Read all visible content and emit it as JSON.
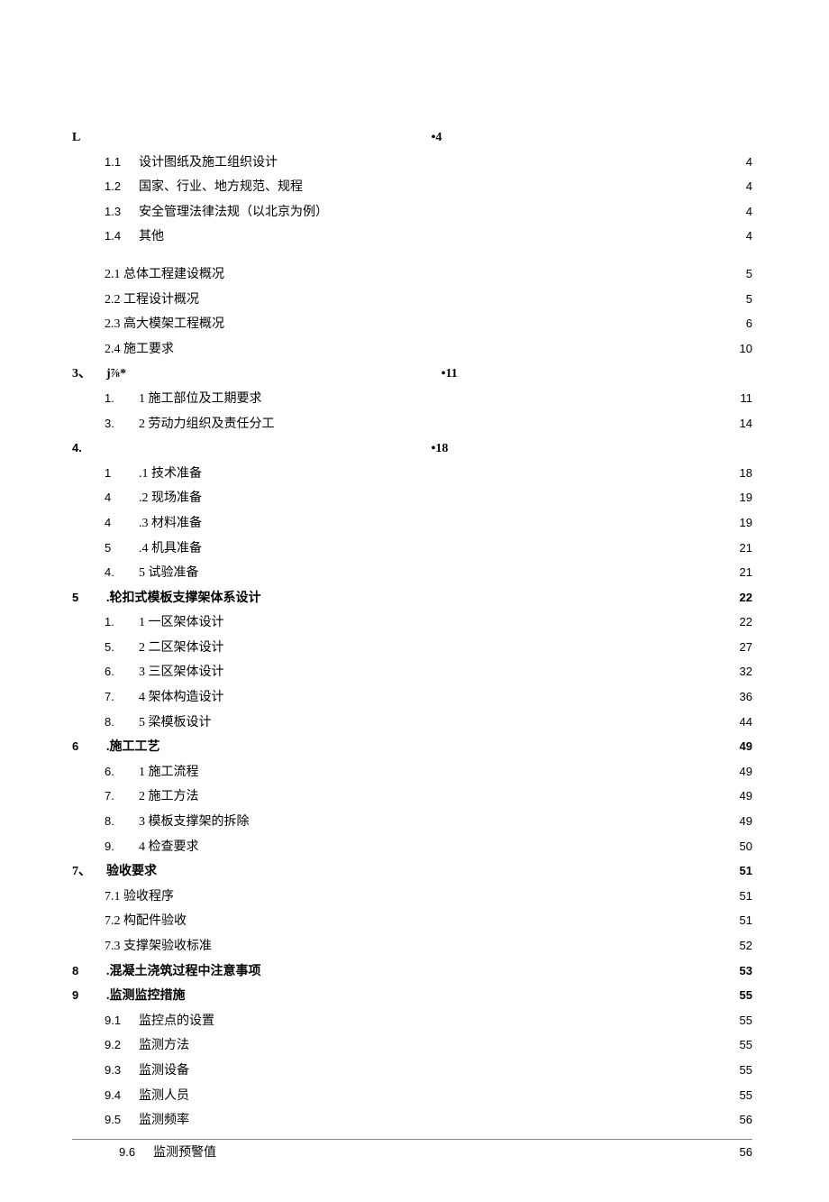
{
  "toc": [
    {
      "level": 1,
      "num": "L",
      "numClass": "cn",
      "text": "",
      "leader": "thick",
      "page": "4",
      "hasPage": false,
      "inlinePage": "•4"
    },
    {
      "level": 2,
      "num": "1.1",
      "text": "设计图纸及施工组织设计",
      "page": "4"
    },
    {
      "level": 2,
      "num": "1.2",
      "text": "国家、行业、地方规范、规程",
      "page": "4"
    },
    {
      "level": 2,
      "num": "1.3",
      "text": "安全管理法律法规（以北京为例）",
      "page": "4"
    },
    {
      "level": 2,
      "num": "1.4",
      "text": "其他",
      "page": "4"
    },
    {
      "gap": true
    },
    {
      "level": 2,
      "num": "",
      "text": "2.1 总体工程建设概况",
      "page": "5"
    },
    {
      "level": 2,
      "num": "",
      "text": "2.2 工程设计概况",
      "page": "5"
    },
    {
      "level": 2,
      "num": "",
      "text": "2.3 高大模架工程概况",
      "page": "6"
    },
    {
      "level": 2,
      "num": "",
      "text": "2.4 施工要求",
      "page": "10"
    },
    {
      "level": 1,
      "num": "3、",
      "numClass": "cn",
      "text": "j⅞*",
      "leader": "thick",
      "page": "11",
      "hasPage": false,
      "inlinePage": "•11"
    },
    {
      "level": 2,
      "num": "1.",
      "text": "1 施工部位及工期要求",
      "page": "11"
    },
    {
      "level": 2,
      "num": "3.",
      "text": "2 劳动力组织及责任分工",
      "page": "14"
    },
    {
      "level": 1,
      "num": "4.",
      "text": "",
      "leader": "thick",
      "page": "18",
      "hasPage": false,
      "inlinePage": "•18"
    },
    {
      "level": 2,
      "num": "1",
      "text": ".1 技术准备",
      "page": "18"
    },
    {
      "level": 2,
      "num": "4",
      "text": ".2 现场准备",
      "page": "19"
    },
    {
      "level": 2,
      "num": "4",
      "text": ".3 材料准备",
      "page": "19"
    },
    {
      "level": 2,
      "num": "5",
      "text": ".4 机具准备",
      "page": "21"
    },
    {
      "level": 2,
      "num": "4.",
      "text": "5 试验准备",
      "page": "21"
    },
    {
      "level": 1,
      "num": "5",
      "text": ".轮扣式模板支撑架体系设计",
      "leader": "dot",
      "page": "22",
      "bold": true
    },
    {
      "level": 2,
      "num": "1.",
      "text": "1 一区架体设计",
      "page": "22"
    },
    {
      "level": 2,
      "num": "5.",
      "text": "2 二区架体设计",
      "page": "27"
    },
    {
      "level": 2,
      "num": "6.",
      "text": "3 三区架体设计",
      "page": "32"
    },
    {
      "level": 2,
      "num": "7.",
      "text": "4 架体构造设计",
      "page": "36"
    },
    {
      "level": 2,
      "num": "8.",
      "text": "5 梁模板设计",
      "page": "44"
    },
    {
      "level": 1,
      "num": "6",
      "text": ".施工工艺",
      "leader": "dot",
      "page": "49",
      "bold": true
    },
    {
      "level": 2,
      "num": "6.",
      "text": "1 施工流程",
      "page": "49"
    },
    {
      "level": 2,
      "num": "7.",
      "text": "2 施工方法",
      "page": "49"
    },
    {
      "level": 2,
      "num": "8.",
      "text": "3 模板支撑架的拆除",
      "page": "49"
    },
    {
      "level": 2,
      "num": "9.",
      "text": "4 检查要求",
      "page": "50"
    },
    {
      "level": 1,
      "num": "7、",
      "numClass": "cn",
      "text": "验收要求",
      "leader": "dot",
      "page": "51",
      "bold": true
    },
    {
      "level": 2,
      "num": "",
      "text": "7.1 验收程序",
      "page": "51"
    },
    {
      "level": 2,
      "num": "",
      "text": "7.2 构配件验收",
      "page": "51"
    },
    {
      "level": 2,
      "num": "",
      "text": "7.3 支撑架验收标准",
      "page": "52"
    },
    {
      "level": 1,
      "num": "8",
      "text": ".混凝土浇筑过程中注意事项",
      "leader": "dot",
      "page": "53",
      "bold": true
    },
    {
      "level": 1,
      "num": "9",
      "text": ".监测监控措施",
      "leader": "dot",
      "page": "55",
      "bold": true
    },
    {
      "level": 2,
      "num": "9.1",
      "text": "监控点的设置",
      "page": "55"
    },
    {
      "level": 2,
      "num": "9.2",
      "text": "监测方法",
      "page": "55"
    },
    {
      "level": 2,
      "num": "9.3",
      "text": "监测设备",
      "page": "55"
    },
    {
      "level": 2,
      "num": "9.4",
      "text": "监测人员",
      "page": "55"
    },
    {
      "level": 2,
      "num": "9.5",
      "text": "监测频率",
      "page": "56"
    },
    {
      "hr": true
    },
    {
      "level": "2b",
      "num": "9.6",
      "text": "监测预警值",
      "page": "56"
    }
  ]
}
